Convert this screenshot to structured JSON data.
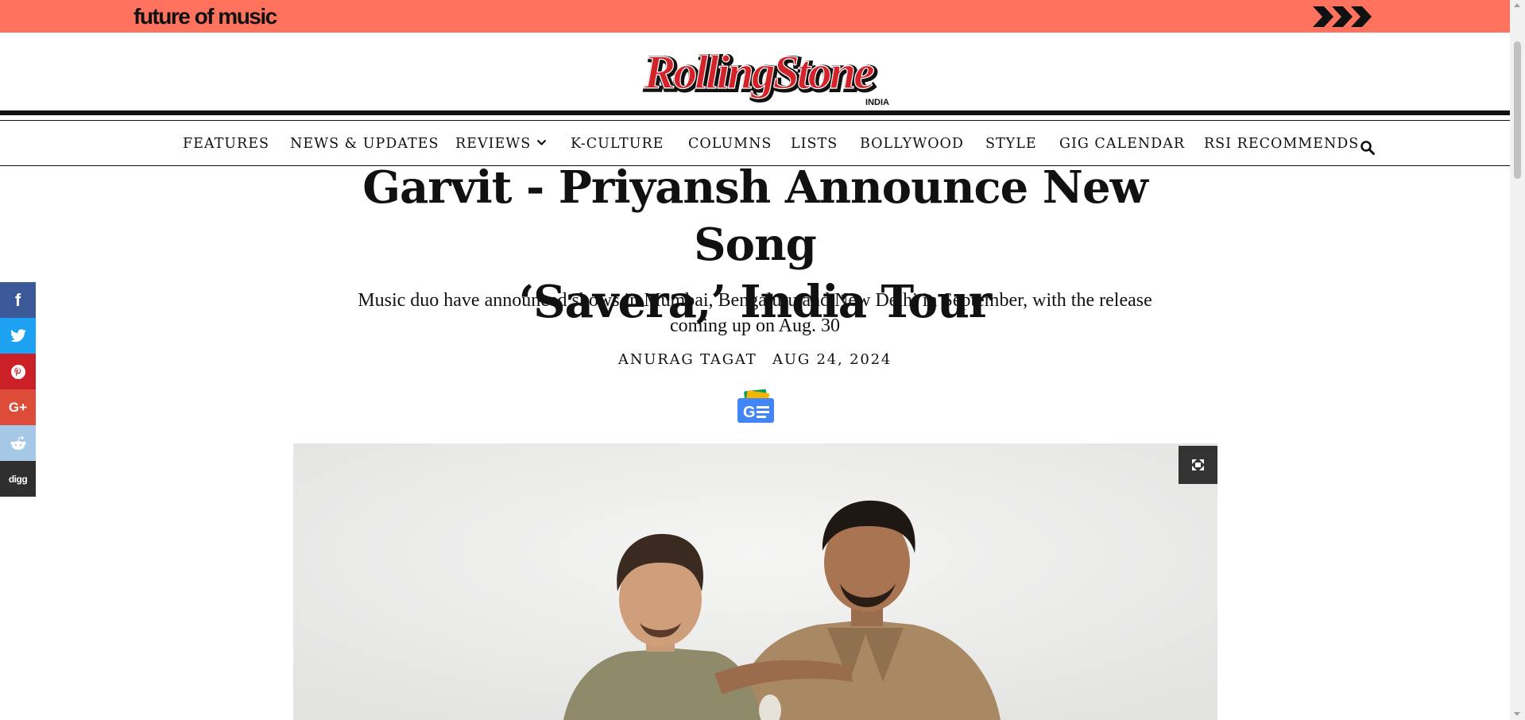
{
  "promo": {
    "text": "future of music",
    "arrow_icon": "triple-chevron-right-icon",
    "background": "#ff735e"
  },
  "brand": {
    "name": "RollingStone",
    "edition": "INDIA",
    "color": "#d2232a"
  },
  "nav": {
    "items": [
      {
        "label": "FEATURES"
      },
      {
        "label": "NEWS & UPDATES"
      },
      {
        "label": "REVIEWS",
        "dropdown": true
      },
      {
        "label": "K-CULTURE"
      },
      {
        "label": "COLUMNS"
      },
      {
        "label": "LISTS"
      },
      {
        "label": "BOLLYWOOD"
      },
      {
        "label": "STYLE"
      },
      {
        "label": "GIG CALENDAR"
      },
      {
        "label": "RSI RECOMMENDS"
      }
    ],
    "search_icon": "search-icon"
  },
  "article": {
    "title_line1": "Garvit - Priyansh Announce New Song",
    "title_line2": "‘Savera,’ India Tour",
    "dek_line1": "Music duo have announced shows in Mumbai, Bengaluru and New Delhi in September, with the release",
    "dek_line2": "coming up on Aug. 30",
    "author": "ANURAG TAGAT",
    "date": "AUG 24, 2024",
    "google_news_icon": "google-news-icon",
    "expand_icon": "expand-icon"
  },
  "share": [
    {
      "network": "facebook",
      "icon": "facebook-icon",
      "glyph": "f",
      "color": "#3b5998"
    },
    {
      "network": "twitter",
      "icon": "twitter-icon",
      "glyph": "",
      "color": "#1da1f2"
    },
    {
      "network": "pinterest",
      "icon": "pinterest-icon",
      "glyph": "",
      "color": "#cb2027"
    },
    {
      "network": "google-plus",
      "icon": "google-plus-icon",
      "glyph": "G+",
      "color": "#dd4b39"
    },
    {
      "network": "reddit",
      "icon": "reddit-icon",
      "glyph": "",
      "color": "#a4c8e6"
    },
    {
      "network": "digg",
      "icon": "digg-icon",
      "glyph": "digg",
      "color": "#2f2f2f"
    }
  ]
}
